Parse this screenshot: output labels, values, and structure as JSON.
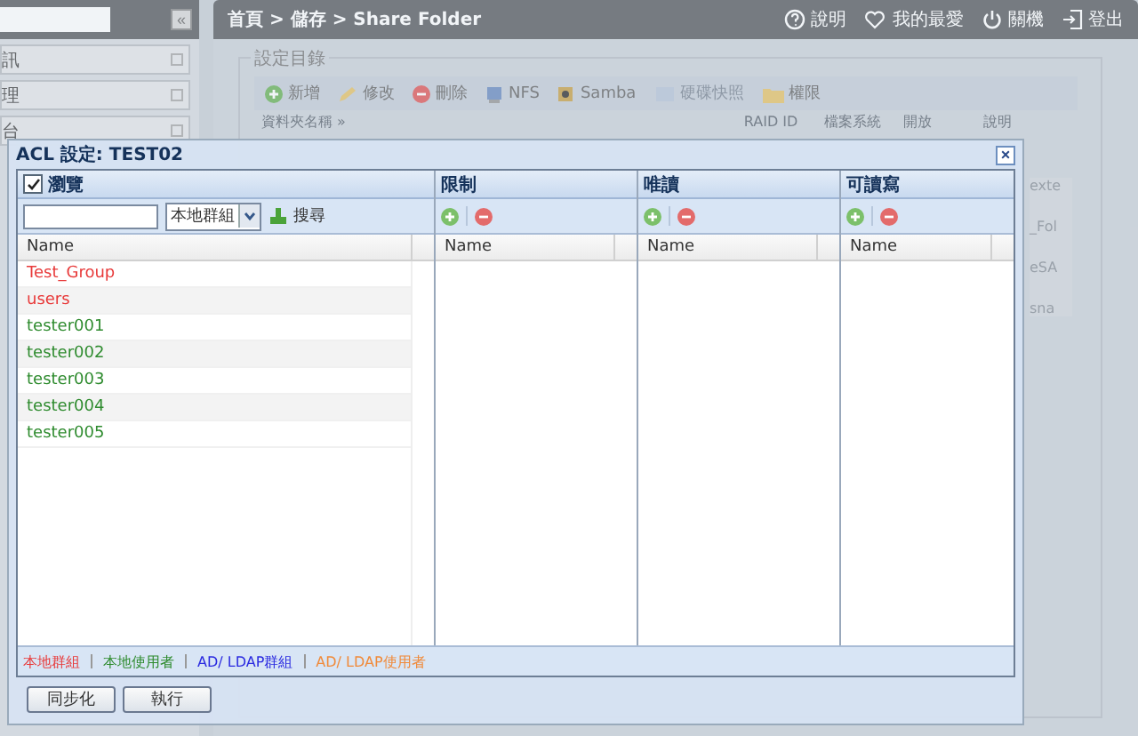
{
  "sidebar": {
    "collapse_button": "«",
    "items": [
      {
        "label": "訊"
      },
      {
        "label": "理"
      },
      {
        "label": "台"
      }
    ]
  },
  "topbar": {
    "breadcrumb": "首頁 > 儲存 > Share Folder",
    "links": [
      {
        "label": "說明"
      },
      {
        "label": "我的最愛"
      },
      {
        "label": "關機"
      },
      {
        "label": "登出"
      }
    ]
  },
  "panel": {
    "title": "設定目錄",
    "toolbar": [
      {
        "label": "新增",
        "disabled": false
      },
      {
        "label": "修改",
        "disabled": false
      },
      {
        "label": "刪除",
        "disabled": false
      },
      {
        "label": "NFS",
        "disabled": false
      },
      {
        "label": "Samba",
        "disabled": false
      },
      {
        "label": "硬碟快照",
        "disabled": true
      },
      {
        "label": "權限",
        "disabled": false
      }
    ],
    "table": {
      "columns": [
        "資料夾名稱 »",
        "RAID ID",
        "檔案系統",
        "開放",
        "說明"
      ],
      "edge_texts": [
        "exte",
        "_Fol",
        "eSA",
        "sna"
      ]
    }
  },
  "dialog": {
    "title": "ACL 設定: TEST02",
    "close": "×",
    "browse": {
      "label": "瀏覽",
      "checked": true,
      "scope": "本地群組",
      "search_button": "搜尋",
      "column": "Name",
      "rows": [
        {
          "name": "Test_Group",
          "color": "#e83a3a"
        },
        {
          "name": "users",
          "color": "#e83a3a"
        },
        {
          "name": "tester001",
          "color": "#2e8b2e"
        },
        {
          "name": "tester002",
          "color": "#2e8b2e"
        },
        {
          "name": "tester003",
          "color": "#2e8b2e"
        },
        {
          "name": "tester004",
          "color": "#2e8b2e"
        },
        {
          "name": "tester005",
          "color": "#2e8b2e"
        }
      ]
    },
    "panes": [
      {
        "title": "限制",
        "column": "Name"
      },
      {
        "title": "唯讀",
        "column": "Name"
      },
      {
        "title": "可讀寫",
        "column": "Name"
      }
    ],
    "legend": [
      {
        "label": "本地群組",
        "color": "#e83a3a"
      },
      {
        "label": "本地使用者",
        "color": "#2e8b2e"
      },
      {
        "label": "AD/ LDAP群組",
        "color": "#2a2ae0"
      },
      {
        "label": "AD/ LDAP使用者",
        "color": "#f08a3a"
      }
    ],
    "buttons": [
      "同步化",
      "執行"
    ]
  }
}
